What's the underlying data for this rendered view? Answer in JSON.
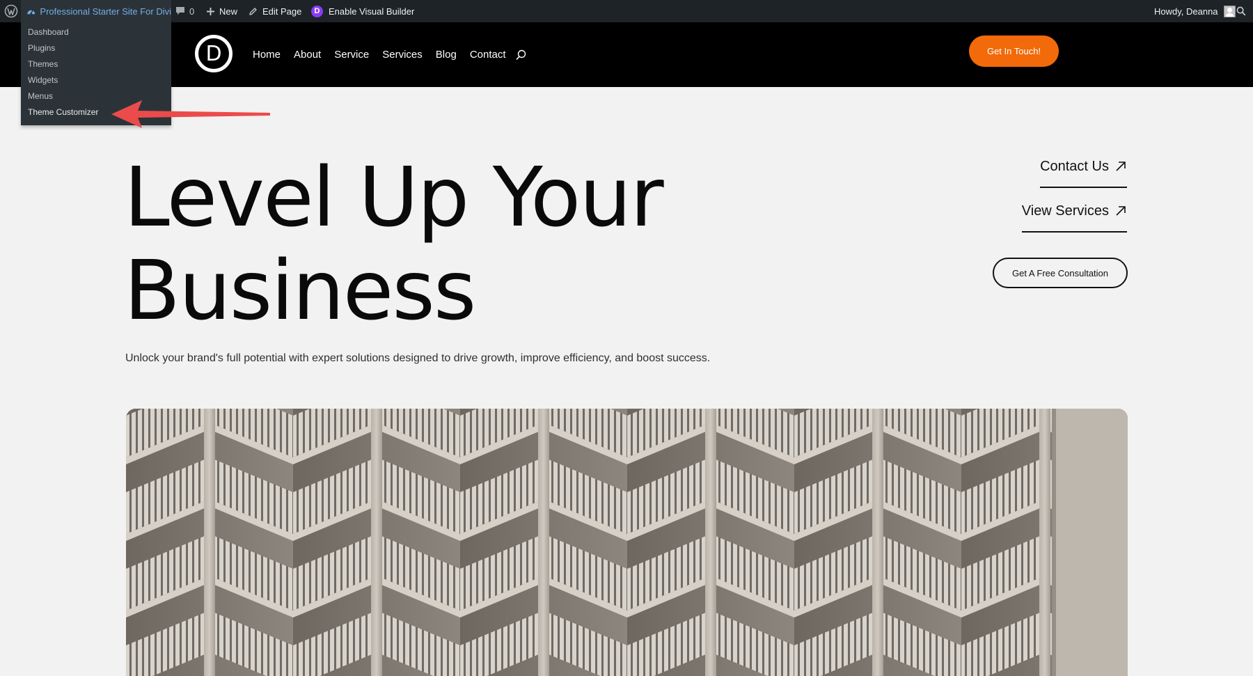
{
  "admin_bar": {
    "site_name": "Professional Starter Site For Divi",
    "comments_count": "0",
    "new_label": "New",
    "edit_page_label": "Edit Page",
    "visual_builder_label": "Enable Visual Builder",
    "divi_badge": "D",
    "greeting": "Howdy, Deanna",
    "site_menu": [
      {
        "label": "Dashboard"
      },
      {
        "label": "Plugins"
      },
      {
        "label": "Themes"
      },
      {
        "label": "Widgets"
      },
      {
        "label": "Menus"
      },
      {
        "label": "Theme Customizer"
      }
    ],
    "icons": {
      "wordpress": "wordpress-logo-icon",
      "site": "dashboard-gauge-icon",
      "comments": "comment-bubble-icon",
      "new": "plus-icon",
      "edit": "pencil-icon",
      "search": "search-icon"
    }
  },
  "header": {
    "logo_letter": "D",
    "nav": [
      {
        "label": "Home"
      },
      {
        "label": "About"
      },
      {
        "label": "Service"
      },
      {
        "label": "Services"
      },
      {
        "label": "Blog"
      },
      {
        "label": "Contact"
      }
    ],
    "cta_label": "Get In Touch!"
  },
  "hero": {
    "title_line1": "Level Up Your",
    "title_line2": "Business",
    "subtitle": "Unlock your brand's full potential with expert solutions designed to drive growth, improve efficiency, and boost success.",
    "contact_link": "Contact Us",
    "services_link": "View Services",
    "consult_button": "Get A Free Consultation"
  },
  "colors": {
    "admin_bar_bg": "#1d2327",
    "admin_dropdown_bg": "#2c3338",
    "admin_link": "#72aee6",
    "header_bg": "#000000",
    "cta_orange": "#f26a0a",
    "page_bg": "#f2f2f2",
    "annotation_red": "#ec4b4b",
    "divi_purple": "#8b3cf6"
  }
}
